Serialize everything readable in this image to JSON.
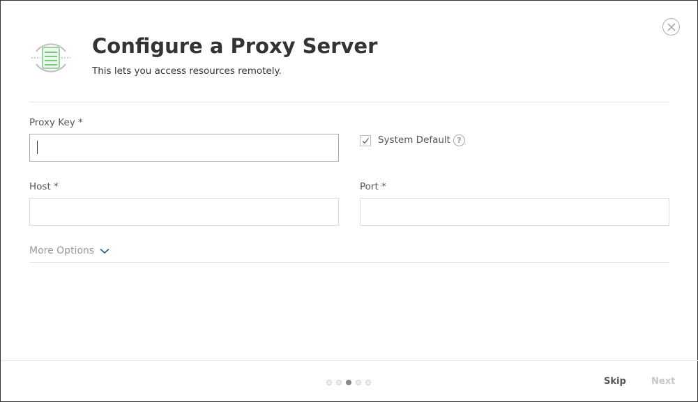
{
  "header": {
    "title": "Configure a Proxy Server",
    "subtitle": "This lets you access resources remotely.",
    "icon": "proxy-server-icon"
  },
  "form": {
    "proxy_key": {
      "label": "Proxy Key *",
      "value": "",
      "placeholder": ""
    },
    "system_default": {
      "label": "System Default",
      "checked": true
    },
    "host": {
      "label": "Host *",
      "value": "",
      "placeholder": ""
    },
    "port": {
      "label": "Port *",
      "value": "",
      "placeholder": ""
    },
    "more_options_label": "More Options"
  },
  "footer": {
    "steps_total": 5,
    "active_step": 3,
    "skip_label": "Skip",
    "next_label": "Next"
  },
  "colors": {
    "icon_green": "#7cc47f",
    "chevron_blue": "#1f5f8b",
    "next_disabled": "#c8c8c8"
  }
}
